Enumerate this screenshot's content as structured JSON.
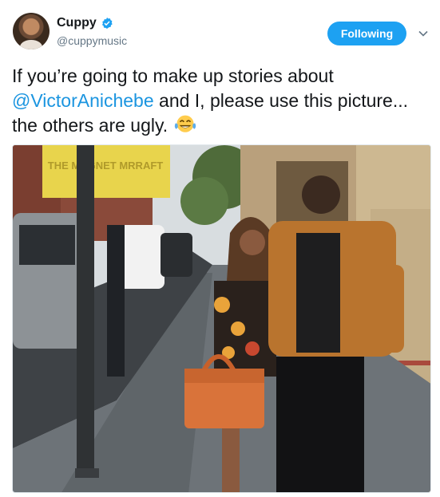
{
  "user": {
    "display_name": "Cuppy",
    "handle": "@cuppymusic",
    "verified": true,
    "avatar_icon": "profile-photo"
  },
  "follow_button": {
    "label": "Following"
  },
  "menu": {
    "icon": "chevron-down-icon"
  },
  "tweet": {
    "text_before": "If you’re going to make up stories about ",
    "mention": "@VictorAnichebe",
    "text_after": " and I, please use this picture... the others are ugly. ",
    "emoji": "face-with-tears-of-joy"
  },
  "photo": {
    "sign_text": "THE MAGNET MRRAFT"
  },
  "colors": {
    "accent": "#1da1f2",
    "mention": "#1b95e0",
    "text": "#14171a",
    "secondary": "#657786"
  }
}
